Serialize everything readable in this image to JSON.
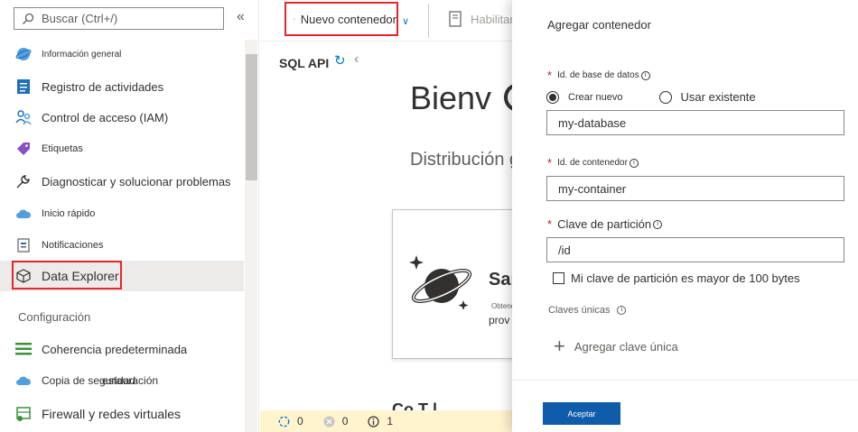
{
  "sidebar": {
    "search_placeholder": "Buscar (Ctrl+/)",
    "collapse_icon": "«",
    "items": [
      {
        "label": "Información general",
        "icon": "cosmos-overview-icon"
      },
      {
        "label": "Registro de actividades",
        "icon": "activity-log-icon"
      },
      {
        "label": "Control de acceso (IAM)",
        "icon": "iam-people-icon"
      },
      {
        "label": "Etiquetas",
        "icon": "tag-icon"
      },
      {
        "label": "Diagnosticar y solucionar problemas",
        "icon": "wrench-icon"
      },
      {
        "label": "Inicio rápido",
        "icon": "cloud-quickstart-icon"
      },
      {
        "label": "Notificaciones",
        "icon": "notification-icon"
      },
      {
        "label": "Data Explorer",
        "icon": "cube-icon"
      }
    ],
    "section_config": "Configuración",
    "config_items": [
      {
        "label": "Coherencia predeterminada",
        "icon": "bars-icon"
      },
      {
        "label": "Copia de seguridad",
        "overlay": "estauración",
        "icon": "cloud-backup-icon"
      },
      {
        "label": "Firewall y redes virtuales",
        "icon": "firewall-icon"
      }
    ]
  },
  "toolbar": {
    "new_container": "Nuevo contenedor",
    "enable": "Habilitar"
  },
  "main": {
    "api_label": "SQL API",
    "welcome": "Bienv",
    "distribution": "Distribución glo…",
    "card_title": "Sar",
    "card_small": "Obtener",
    "card_sub": "prov",
    "bottom_text": "Co     T    l",
    "status": {
      "pending": "0",
      "errors": "0",
      "info": "1"
    }
  },
  "panel": {
    "title": "Agregar contenedor",
    "db_id_label": "Id. de base de datos",
    "radio_new": "Crear nuevo",
    "radio_existing": "Usar existente",
    "db_id_value": "my-database",
    "container_id_label": "Id. de contenedor",
    "container_id_value": "my-container",
    "partition_key_label": "Clave de partición",
    "partition_key_value": "/id",
    "partition_large_label": "Mi clave de partición es mayor de 100 bytes",
    "unique_keys_label": "Claves únicas",
    "add_unique_key": "Agregar clave única",
    "ok_button": "Aceptar"
  },
  "colors": {
    "accent": "#0078d4",
    "highlight_border": "#e3262b",
    "ok_button": "#0f5caa",
    "status_bar": "#fff4ce"
  }
}
